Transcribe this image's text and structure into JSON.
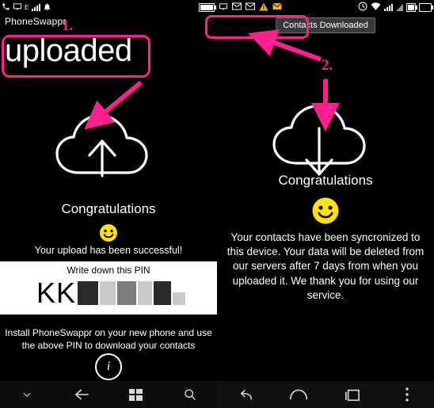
{
  "left_phone": {
    "statusbar": {
      "icons": [
        "phone-icon",
        "monitor-icon",
        "signal-e-icon",
        "signal-bars-icon",
        "bell-icon",
        "battery-icon"
      ],
      "carrier_label": "E"
    },
    "app_title": "PhoneSwappr",
    "headline": "uploaded",
    "cloud_icon": "cloud-upload-icon",
    "congrats": "Congratulations",
    "smiley": "🙂",
    "success_msg": "Your upload has been successful!",
    "pin_panel": {
      "label": "Write down this PIN",
      "pin_visible": "KK",
      "pin_redacted": "████"
    },
    "install_note": "Install PhoneSwappr on your new phone and use the above PIN to download your contacts",
    "info_icon": "info-icon",
    "navbar": [
      "back-chevron-icon",
      "back-arrow-icon",
      "windows-home-icon",
      "search-icon"
    ]
  },
  "right_phone": {
    "statusbar": {
      "icons": [
        "monitor-icon",
        "mail-icon",
        "mail-icon",
        "warning-icon",
        "mail-icon",
        "clock-icon",
        "wifi-icon",
        "signal-bars-icon",
        "signal-triangle-icon",
        "battery-icon",
        "battery-icon"
      ]
    },
    "toast": "Contacts Downloaded",
    "cloud_icon": "cloud-download-icon",
    "congrats": "Congratulations",
    "smiley": "🙂",
    "message": "Your contacts have been syncronized to this device. Your data will be deleted from our servers after 7 days from when you uploaded it. We thank you for using our service.",
    "navbar": [
      "back-arrow-icon",
      "home-icon",
      "recents-icon",
      "overflow-menu-icon"
    ]
  },
  "annotations": {
    "accent_color": "#ff1f8f",
    "marker_1": "1.",
    "marker_2": "2."
  }
}
